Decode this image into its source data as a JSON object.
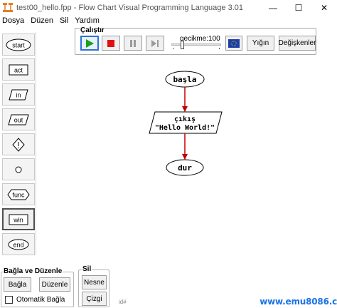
{
  "window": {
    "title": "test00_hello.fpp - Flow Chart Visual Programming Language 3.01",
    "controls": {
      "minimize": "—",
      "maximize": "☐",
      "close": "✕"
    }
  },
  "menu": [
    "Dosya",
    "Düzen",
    "Sil",
    "Yardım"
  ],
  "palette": [
    {
      "label": "start",
      "icon": "terminator-shape-icon"
    },
    {
      "label": "act",
      "icon": "process-shape-icon"
    },
    {
      "label": "in",
      "icon": "input-shape-icon"
    },
    {
      "label": "out",
      "icon": "output-shape-icon"
    },
    {
      "label": "",
      "icon": "decision-shape-icon"
    },
    {
      "label": "",
      "icon": "connector-shape-icon"
    },
    {
      "label": "func",
      "icon": "function-shape-icon"
    },
    {
      "label": "win",
      "icon": "window-shape-icon",
      "selected": true
    },
    {
      "label": "end",
      "icon": "end-shape-icon"
    }
  ],
  "run_toolbar": {
    "legend": "Çalıştır",
    "delay_label": "gecikme:100",
    "delay_value": 100,
    "delay_fraction": 0.2,
    "stack_button": "Yığın",
    "variables_button": "Değişkenler",
    "colors": {
      "play": "#1aa01a",
      "stop": "#e01010",
      "flag_blue": "#1c3fa8"
    }
  },
  "flowchart": {
    "start_label": "başla",
    "output_line1": "çıkış",
    "output_line2": "\"Hello World!\"",
    "end_label": "dur",
    "arrow_color": "#c00000"
  },
  "connect_panel": {
    "legend": "Bağla ve Düzenle",
    "connect_button": "Bağla",
    "edit_button": "Düzenle",
    "auto_connect_label": "Otomatik Bağla",
    "auto_connect_checked": false
  },
  "delete_panel": {
    "legend": "Sil",
    "object_button": "Nesne",
    "line_button": "Çizgi"
  },
  "status": {
    "text": "id#"
  },
  "watermark": "www.emu8086.c"
}
